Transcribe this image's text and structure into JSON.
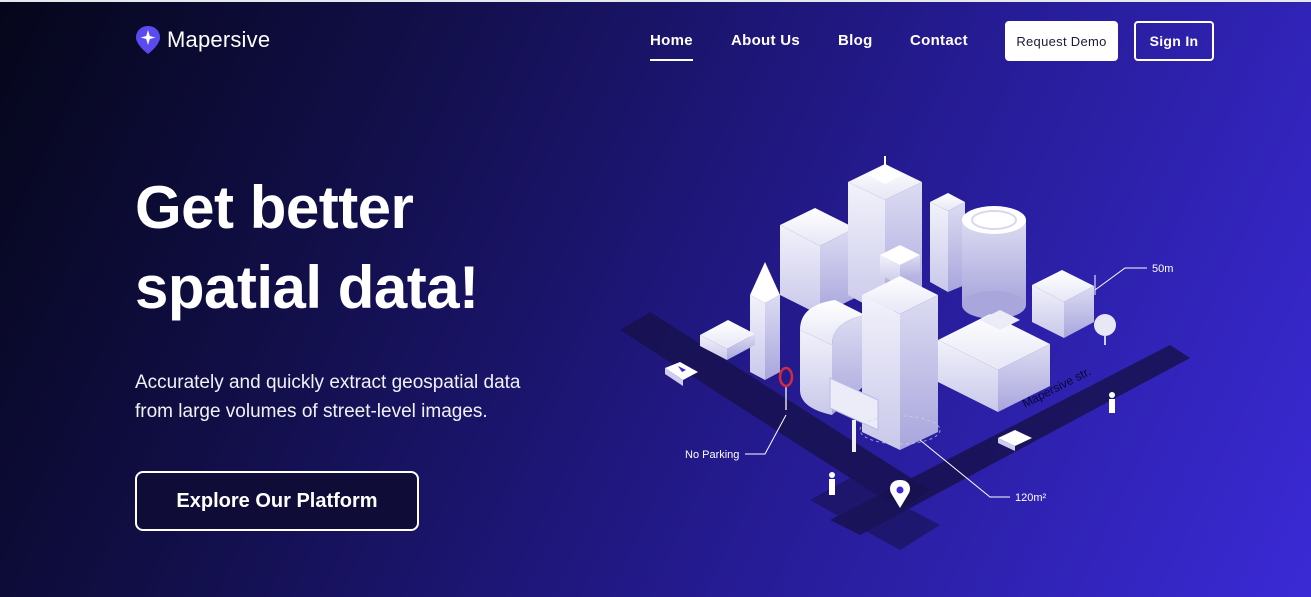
{
  "brand": {
    "name": "Mapersive",
    "logo_icon": "map-pin-sparkle-icon"
  },
  "nav": {
    "links": [
      {
        "label": "Home",
        "active": true
      },
      {
        "label": "About Us",
        "active": false
      },
      {
        "label": "Blog",
        "active": false
      },
      {
        "label": "Contact",
        "active": false
      }
    ],
    "request_demo_label": "Request Demo",
    "sign_in_label": "Sign In"
  },
  "hero": {
    "title_line1": "Get better",
    "title_line2": "spatial data!",
    "subtitle_line1": "Accurately and quickly extract geospatial data",
    "subtitle_line2": "from large volumes of street-level images.",
    "cta_label": "Explore Our Platform"
  },
  "illustration": {
    "labels": {
      "height": "50m",
      "street": "Mapersive str.",
      "no_parking": "No Parking",
      "area": "120m²"
    }
  },
  "colors": {
    "bg_dark": "#05061a",
    "bg_mid": "#241a8e",
    "bg_light": "#3a2ad6",
    "accent": "#4b3ce8",
    "white": "#ffffff"
  }
}
